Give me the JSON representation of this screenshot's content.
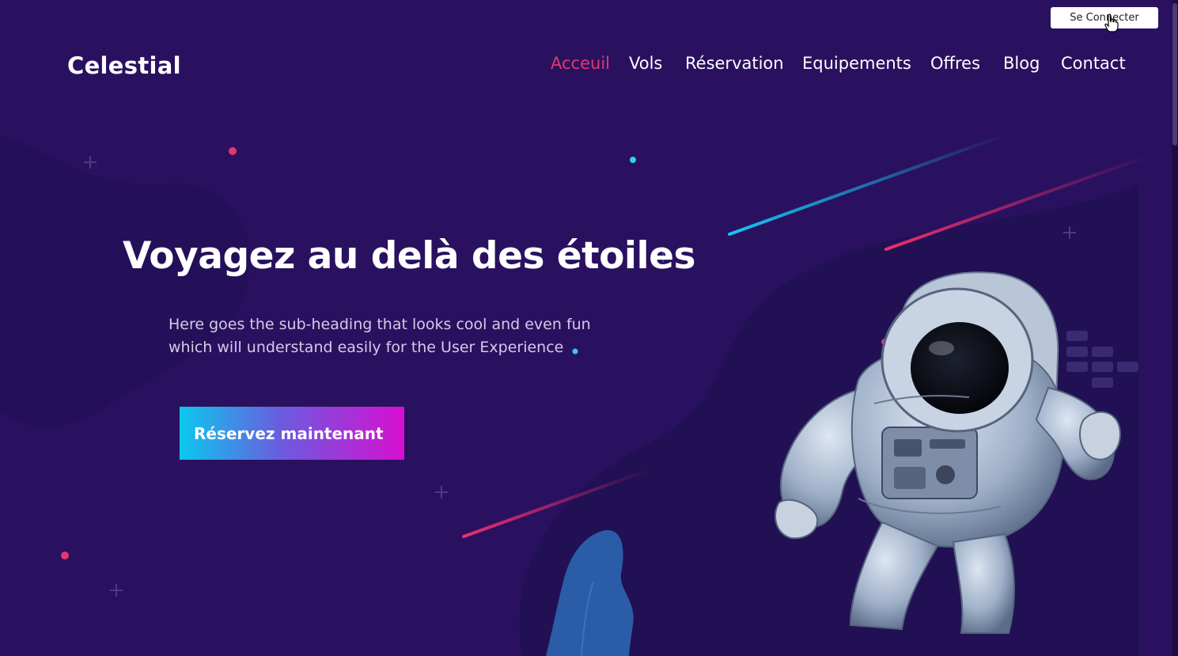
{
  "header": {
    "login_label": "Se Connecter"
  },
  "brand": {
    "name": "Celestial"
  },
  "nav": {
    "items": [
      {
        "label": "Acceuil",
        "active": true
      },
      {
        "label": "Vols",
        "active": false
      },
      {
        "label": "Réservation",
        "active": false
      },
      {
        "label": "Equipements",
        "active": false
      },
      {
        "label": "Offres",
        "active": false
      },
      {
        "label": "Blog",
        "active": false
      },
      {
        "label": "Contact",
        "active": false
      }
    ]
  },
  "hero": {
    "title": "Voyagez au delà des étoiles",
    "subtitle_line1": "Here goes the sub-heading that looks cool and even fun",
    "subtitle_line2": "which will understand easily for the User Experience",
    "cta_label": "Réservez maintenant"
  },
  "icons": {
    "cursor": "hand-pointer-icon",
    "astronaut": "astronaut-illustration",
    "plant": "plant-illustration"
  },
  "colors": {
    "background": "#2a1160",
    "accent_pink": "#e3376e",
    "accent_cyan": "#12c6ef",
    "cta_gradient_start": "#0cc8ef",
    "cta_gradient_end": "#d80fd0"
  }
}
